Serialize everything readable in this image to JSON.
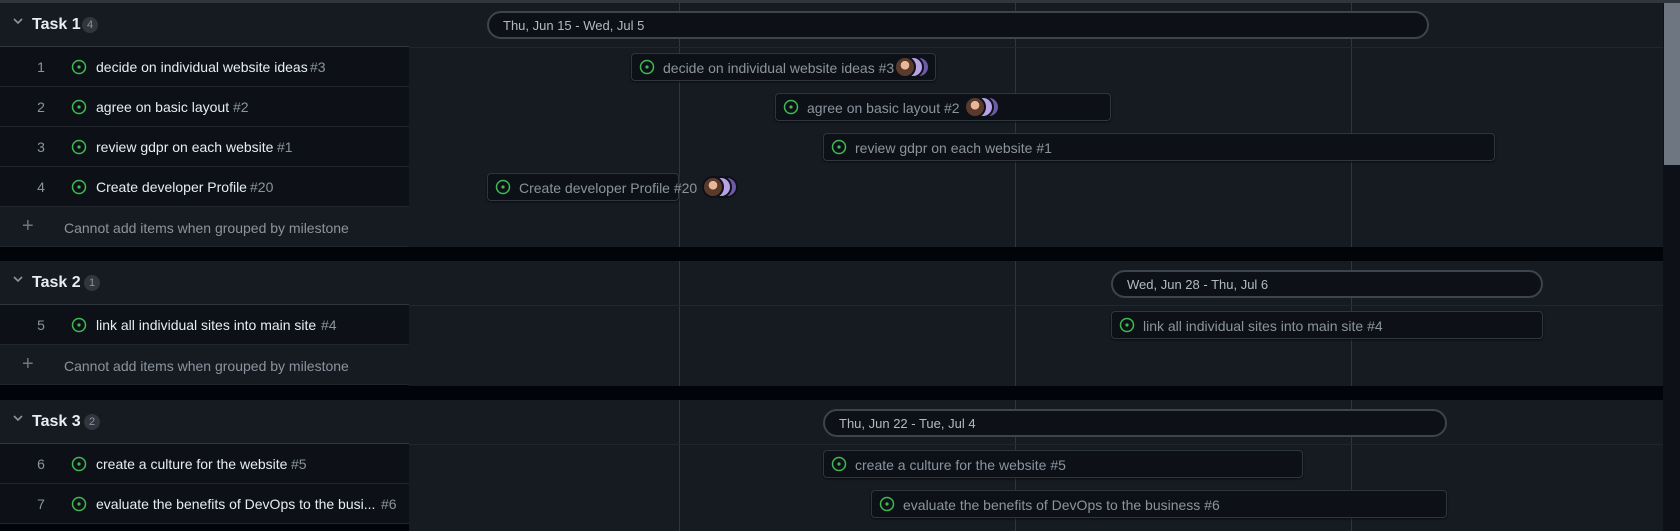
{
  "colors": {
    "status_open": "#3fb950",
    "panel": "#161b22",
    "row": "#0d1117",
    "border": "#30363d"
  },
  "icons": {
    "group_toggle": "chevron-down-icon",
    "status": "issue-open-icon",
    "add": "plus-icon"
  },
  "add_placeholder": "Cannot add items when grouped by milestone",
  "groups": [
    {
      "title": "Task 1",
      "count": "4",
      "range_label": "Thu, Jun 15 - Wed, Jul 5",
      "items": [
        {
          "num": "1",
          "title": "decide on individual website ideas",
          "ref": "#3",
          "bar_label": "decide on individual website ideas #3"
        },
        {
          "num": "2",
          "title": "agree on basic layout",
          "ref": "#2",
          "bar_label": "agree on basic layout #2"
        },
        {
          "num": "3",
          "title": "review gdpr on each website",
          "ref": "#1",
          "bar_label": "review gdpr on each website #1"
        },
        {
          "num": "4",
          "title": "Create developer Profile",
          "ref": "#20",
          "bar_label": "Create developer Profile #20"
        }
      ]
    },
    {
      "title": "Task 2",
      "count": "1",
      "range_label": "Wed, Jun 28 - Thu, Jul 6",
      "items": [
        {
          "num": "5",
          "title": "link all individual sites into main site",
          "ref": "#4",
          "bar_label": "link all individual sites into main site #4"
        }
      ]
    },
    {
      "title": "Task 3",
      "count": "2",
      "range_label": "Thu, Jun 22 - Tue, Jul 4",
      "items": [
        {
          "num": "6",
          "title": "create a culture for the website",
          "ref": "#5",
          "bar_label": "create a culture for the website #5"
        },
        {
          "num": "7",
          "title": "evaluate the benefits of DevOps to the busi...",
          "ref": "#6",
          "bar_label": "evaluate the benefits of DevOps to the business #6"
        }
      ]
    }
  ]
}
